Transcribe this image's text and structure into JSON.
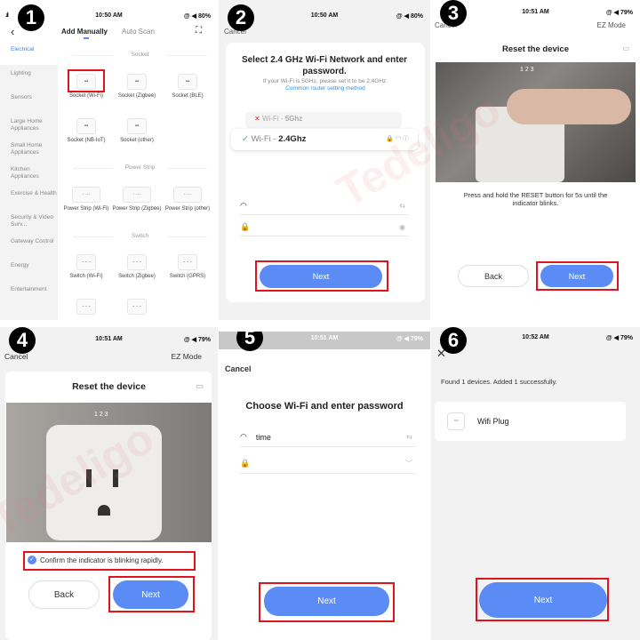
{
  "watermark": "Tedeligo",
  "steps": [
    "1",
    "2",
    "3",
    "4",
    "5",
    "6"
  ],
  "p1": {
    "time": "10:50 AM",
    "battery": "@ ◀ 80%",
    "tabs": [
      "Add Manually",
      "Auto Scan"
    ],
    "sidebar": [
      "Electrical",
      "Lighting",
      "Sensors",
      "Large Home Appliances",
      "Small Home Appliances",
      "Kitchen Appliances",
      "Exercise & Health",
      "Security & Video Surv...",
      "Gateway Control",
      "Energy",
      "Entertainment"
    ],
    "sections": [
      "Socket",
      "Power Strip",
      "Switch"
    ],
    "sockets": [
      "Socket (Wi-Fi)",
      "Socket (Zigbee)",
      "Socket (BLE)",
      "Socket (NB-IoT)",
      "Socket (other)"
    ],
    "strips": [
      "Power Strip (Wi-Fi)",
      "Power Strip (Zigbee)",
      "Power Strip (other)"
    ],
    "switches": [
      "Switch (Wi-Fi)",
      "Switch (Zigbee)",
      "Switch (GPRS)"
    ]
  },
  "p2": {
    "time": "10:50 AM",
    "battery": "@ ◀ 80%",
    "cancel": "Cancel",
    "title": "Select 2.4 GHz Wi-Fi Network and enter password.",
    "subtitle": "If your Wi-Fi is 5GHz, please set it to be 2.4GHz.",
    "link": "Common router setting method",
    "wifi_5g_prefix": "Wi-Fi - ",
    "wifi_5g": "5Ghz",
    "wifi_24_prefix": "Wi-Fi - ",
    "wifi_24": "2.4Ghz",
    "next": "Next"
  },
  "p3": {
    "time": "10:51 AM",
    "battery": "@ ◀ 79%",
    "cancel": "Cancel",
    "mode": "EZ Mode",
    "title": "Reset the device",
    "steps": "1 2 3",
    "instruction": "Press and hold the RESET button for 5s until the indicator blinks.",
    "back": "Back",
    "next": "Next"
  },
  "p4": {
    "time": "10:51 AM",
    "battery": "@ ◀ 79%",
    "cancel": "Cancel",
    "mode": "EZ Mode",
    "title": "Reset the device",
    "steps": "1 2 3",
    "confirm": "Confirm the indicator is blinking rapidly.",
    "confirm_checked": true,
    "back": "Back",
    "next": "Next"
  },
  "p5": {
    "time": "10:51 AM",
    "battery": "@ ◀ 79%",
    "cancel": "Cancel",
    "title": "Choose Wi-Fi and enter password",
    "ssid": "time",
    "password": "",
    "next": "Next"
  },
  "p6": {
    "time": "10:52 AM",
    "battery": "@ ◀ 79%",
    "result": "Found 1 devices. Added 1 successfully.",
    "device": "Wifi Plug",
    "next": "Next"
  },
  "colors": {
    "accent": "#5b8cf5",
    "highlight": "#e0141c",
    "link": "#3a8de0"
  }
}
